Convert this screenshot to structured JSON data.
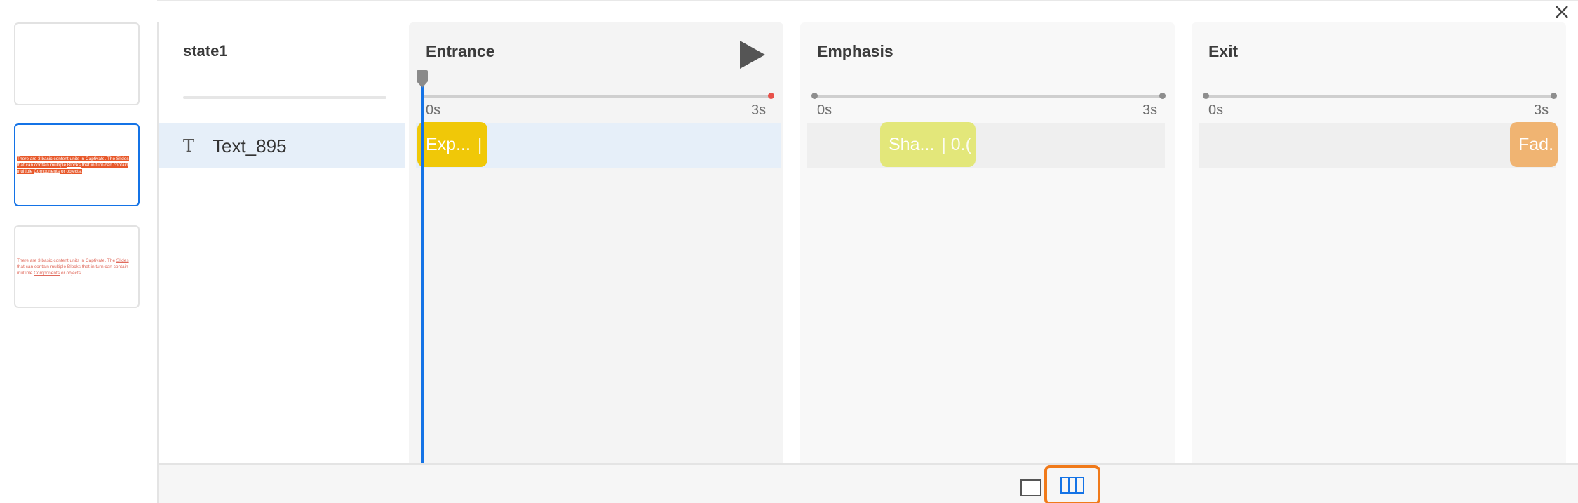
{
  "thumbnails": [
    {
      "text_parts": []
    },
    {
      "text_parts": [
        "There are 3 basic content units in Captivate. The ",
        "Slides",
        " that can contain multiple ",
        "Blocks",
        " that in turn can contain multiple ",
        "Components",
        " or objects."
      ]
    },
    {
      "text_parts": [
        "There are 3 basic content units in Captivate. The ",
        "Slides",
        " that can contain multiple ",
        "Blocks",
        " that in turn can contain multiple ",
        "Components",
        " or objects."
      ]
    }
  ],
  "object_panel": {
    "state_title": "state1",
    "object_icon": "text-type-icon",
    "object_icon_glyph": "T",
    "object_name": "Text_895"
  },
  "columns": {
    "entrance": {
      "title": "Entrance",
      "start_label": "0s",
      "end_label": "3s",
      "clip_label": "Exp...",
      "clip_sep": "|",
      "clip_color": "#f0c808"
    },
    "emphasis": {
      "title": "Emphasis",
      "start_label": "0s",
      "end_label": "3s",
      "clip_label": "Sha...",
      "clip_sep": "| 0.(",
      "clip_color": "#e3e77a"
    },
    "exit": {
      "title": "Exit",
      "start_label": "0s",
      "end_label": "3s",
      "clip_label": "Fad.",
      "clip_sep": "",
      "clip_color": "#f0b472"
    }
  },
  "icons": {
    "close": "close-icon",
    "play": "play-icon",
    "playhead": "playhead-handle-icon",
    "view_single": "single-view-icon",
    "view_multi": "multi-column-view-icon"
  },
  "colors": {
    "accent": "#1473e6",
    "selection_highlight": "#f07a1a",
    "end_marker": "#e8514a"
  }
}
